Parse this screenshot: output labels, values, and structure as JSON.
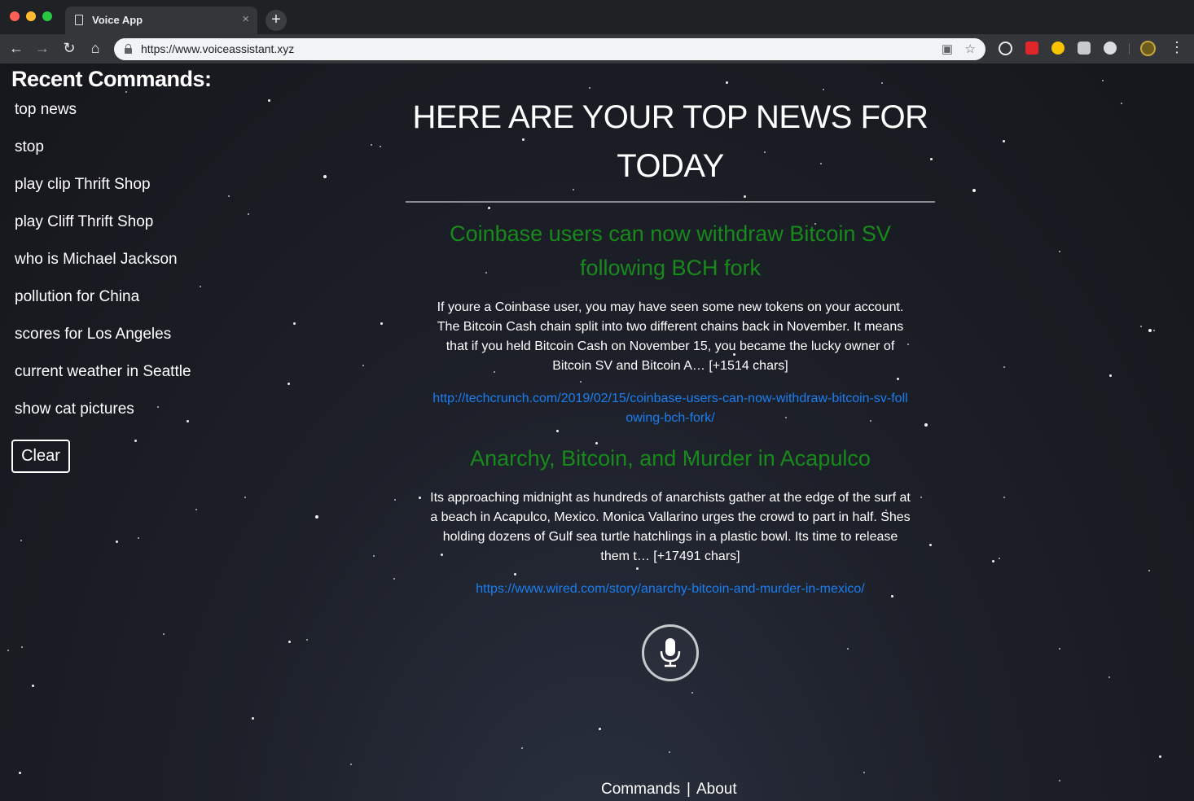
{
  "browser": {
    "tab_title": "Voice App",
    "tab_close": "×",
    "new_tab": "+",
    "url": "https://www.voiceassistant.xyz"
  },
  "sidebar": {
    "title": "Recent Commands:",
    "commands": [
      "top news",
      "stop",
      "play clip Thrift Shop",
      "play Cliff Thrift Shop",
      "who is Michael Jackson",
      "pollution for China",
      "scores for Los Angeles",
      "current weather in Seattle",
      "show cat pictures"
    ],
    "clear_label": "Clear"
  },
  "main": {
    "headline_line1": "HERE ARE YOUR TOP NEWS FOR",
    "headline_line2": "TODAY",
    "articles": [
      {
        "title": "Coinbase users can now withdraw Bitcoin SV following BCH fork",
        "body": "If youre a Coinbase user, you may have seen some new tokens on your account. The Bitcoin Cash chain split into two different chains back in November. It means that if you held Bitcoin Cash on November 15, you became the lucky owner of Bitcoin SV and Bitcoin A… [+1514 chars]",
        "link": "http://techcrunch.com/2019/02/15/coinbase-users-can-now-withdraw-bitcoin-sv-following-bch-fork/"
      },
      {
        "title": "Anarchy, Bitcoin, and Murder in Acapulco",
        "body": "Its approaching midnight as hundreds of anarchists gather at the edge of the surf at a beach in Acapulco, Mexico. Monica Vallarino urges the crowd to part in half. Shes holding dozens of Gulf sea turtle hatchlings in a plastic bowl. Its time to release them t… [+17491 chars]",
        "link": "https://www.wired.com/story/anarchy-bitcoin-and-murder-in-mexico/"
      }
    ]
  },
  "footer": {
    "commands_label": "Commands",
    "separator": "|",
    "about_label": "About"
  },
  "colors": {
    "article_title": "#178a1b",
    "link": "#1b7ef0",
    "background": "#1b1d22"
  }
}
